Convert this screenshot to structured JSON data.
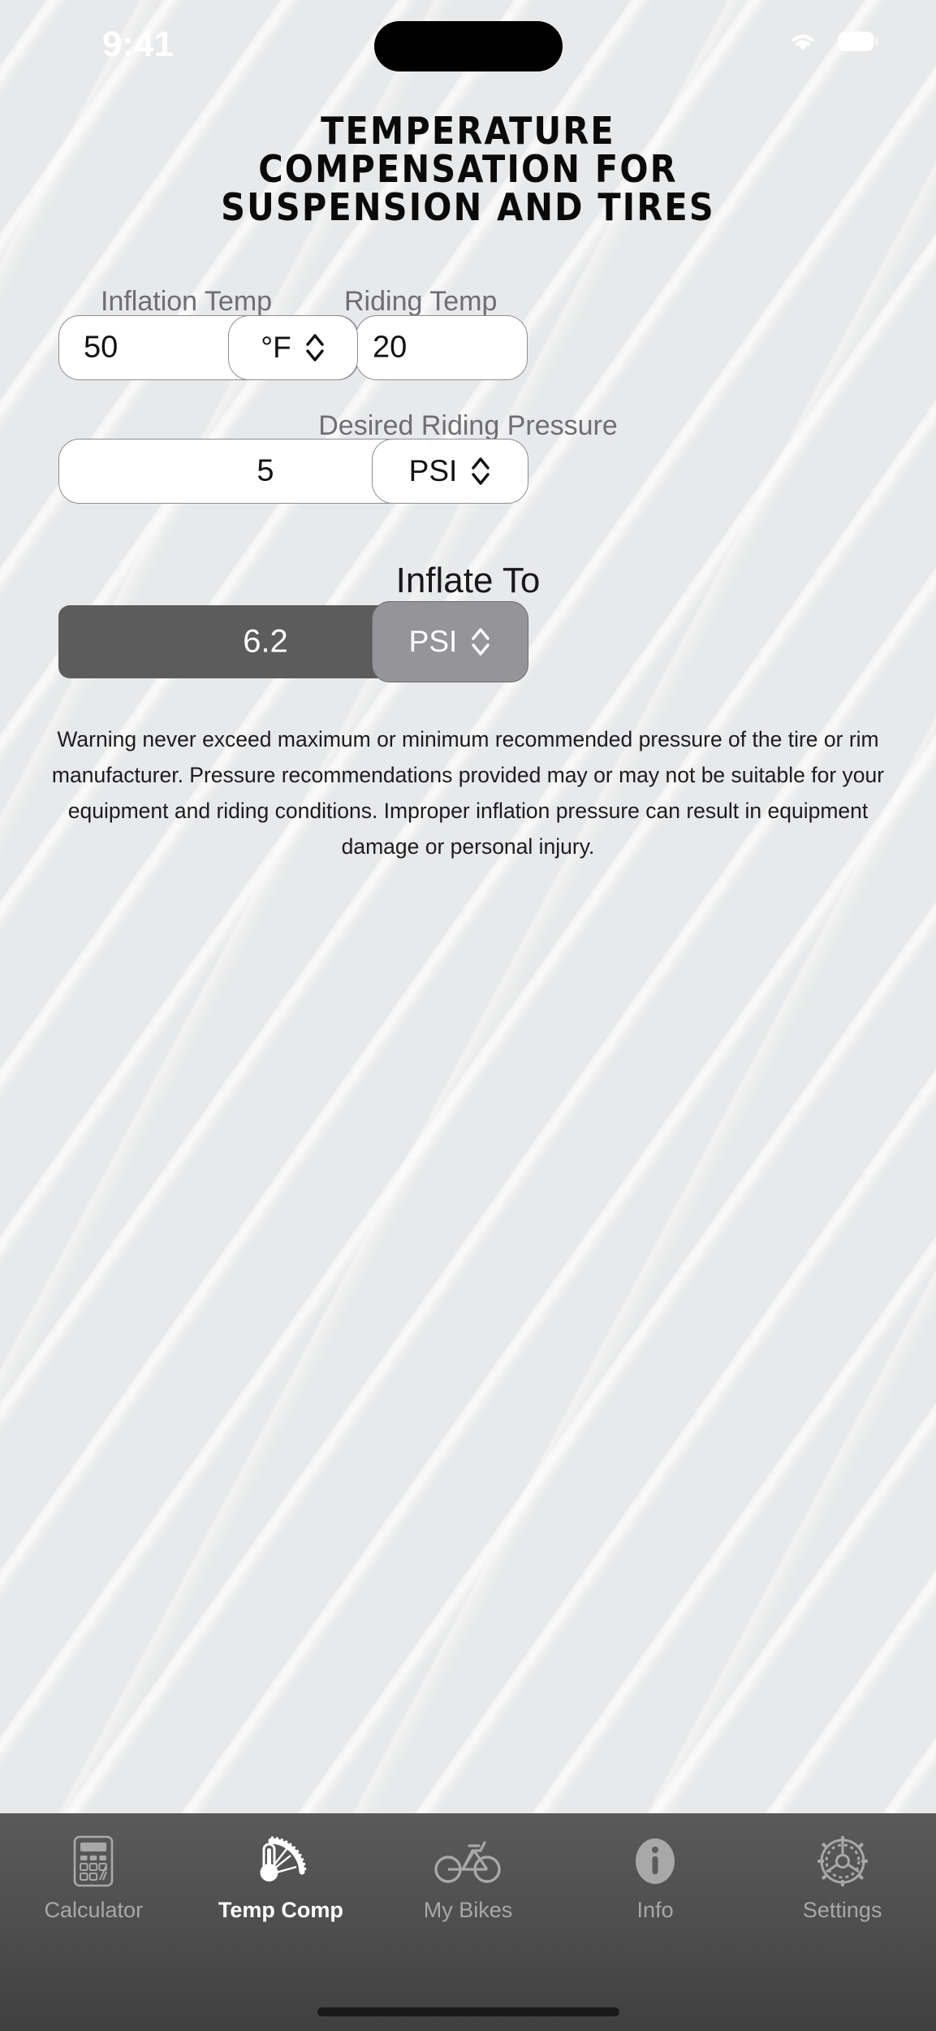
{
  "status_bar": {
    "time": "9:41",
    "wifi_icon": "wifi-icon",
    "battery_icon": "battery-icon",
    "dynamic_island": "dynamic-island"
  },
  "header": {
    "title_line1": "TEMPERATURE",
    "title_line2": "COMPENSATION FOR",
    "title_line3": "SUSPENSION AND TIRES"
  },
  "form": {
    "inflation_temp": {
      "label": "Inflation Temp",
      "value": "50"
    },
    "temp_unit": {
      "value": "°F",
      "stepper_icon": "chevron-up-down-icon"
    },
    "riding_temp": {
      "label": "Riding Temp",
      "value": "20"
    },
    "desired_pressure": {
      "label": "Desired Riding Pressure",
      "value": "5"
    },
    "pressure_unit": {
      "value": "PSI",
      "stepper_icon": "chevron-up-down-icon"
    }
  },
  "result": {
    "heading": "Inflate To",
    "value": "6.2",
    "unit": "PSI",
    "stepper_icon": "chevron-up-down-icon",
    "bar_color": "#5c5c5c",
    "unit_color": "#949499"
  },
  "warning": {
    "text": "Warning never exceed maximum or minimum recommended pressure of the tire or rim manufacturer. Pressure recommendations provided may or may not be suitable for your equipment and riding conditions. Improper inflation pressure can result in equipment damage or personal injury."
  },
  "tab_bar": {
    "items": [
      {
        "label": "Calculator",
        "icon": "calculator-icon",
        "active": false
      },
      {
        "label": "Temp Comp",
        "icon": "temperature-gauge-icon",
        "active": true
      },
      {
        "label": "My Bikes",
        "icon": "bicycle-icon",
        "active": false
      },
      {
        "label": "Info",
        "icon": "info-circle-icon",
        "active": false
      },
      {
        "label": "Settings",
        "icon": "gear-sprocket-icon",
        "active": false
      }
    ],
    "home_indicator": "home-indicator"
  },
  "colors": {
    "background": "#e8e9ea",
    "label_gray": "#6e6e73",
    "tabbar_dark": "#4d4d4d",
    "active_white": "#ffffff",
    "inactive_gray": "#a8a8a8"
  }
}
